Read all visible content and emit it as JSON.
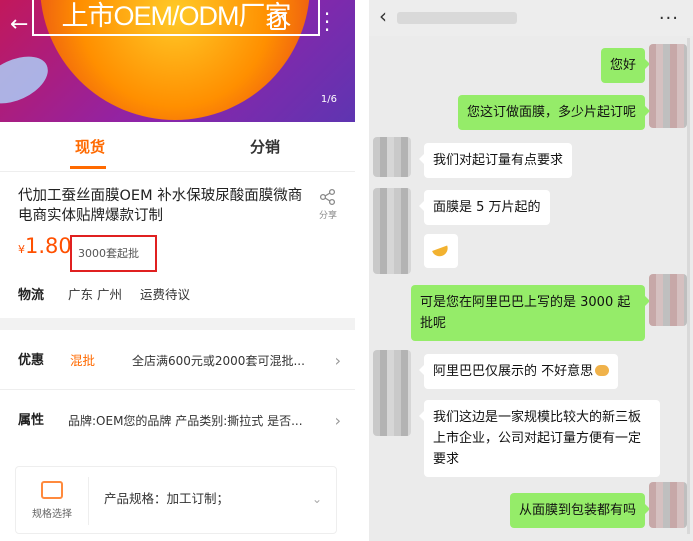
{
  "product": {
    "banner_text": "上市OEM/ODM厂家",
    "image_counter": "1/6",
    "tabs": [
      "现货",
      "分销"
    ],
    "title": "代加工蚕丝面膜OEM 补水保玻尿酸面膜微商电商实体贴牌爆款订制",
    "share_label": "分享",
    "currency": "¥",
    "price": "1.80",
    "moq": "3000套起批",
    "logistics_label": "物流",
    "logistics_city": "广东 广州",
    "logistics_fee": "运费待议",
    "promo_label": "优惠",
    "promo_tag": "混批",
    "promo_text": "全店满600元或2000套可混批...",
    "attr_label": "属性",
    "attr_text": "品牌:OEM您的品牌  产品类别:撕拉式  是否...",
    "spec_caption": "规格选择",
    "spec_text": "产品规格：加工订制；",
    "accent_color": "#ff6a00",
    "highlight_color": "#e02020"
  },
  "chat": {
    "messages": [
      {
        "from": "me",
        "text": "您好"
      },
      {
        "from": "me",
        "text": "您这订做面膜，多少片起订呢"
      },
      {
        "from": "them",
        "text": "我们对起订量有点要求"
      },
      {
        "from": "them",
        "text": "面膜是 5 万片起的"
      },
      {
        "from": "them",
        "text": "",
        "emoji": "banana"
      },
      {
        "from": "me",
        "text": "可是您在阿里巴巴上写的是 3000 起批呢"
      },
      {
        "from": "them",
        "text": "阿里巴巴仅展示的   不好意思",
        "emoji": "wave"
      },
      {
        "from": "them",
        "text": "我们这边是一家规模比较大的新三板上市企业，公司对起订量方便有一定要求"
      },
      {
        "from": "me",
        "text": "从面膜到包装都有吗"
      }
    ],
    "bubble_color_me": "#95ec69",
    "bubble_color_them": "#ffffff"
  }
}
